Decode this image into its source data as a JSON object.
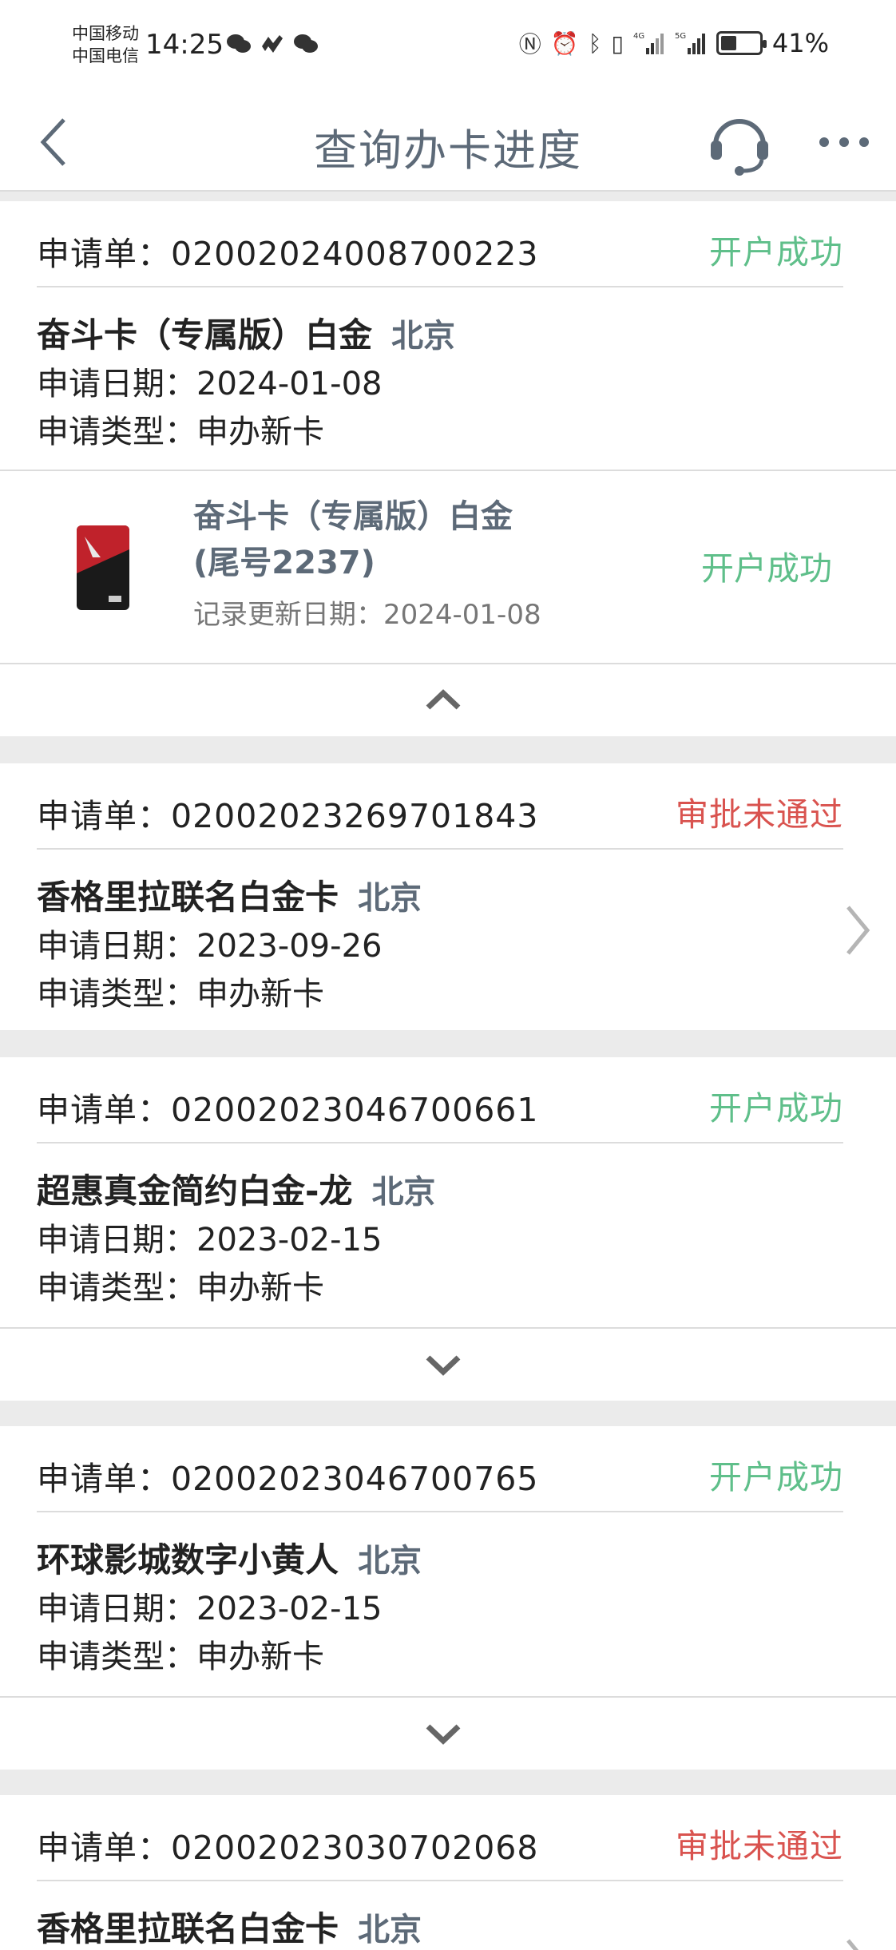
{
  "status_bar": {
    "carrier_1": "中国移动",
    "carrier_2": "中国电信",
    "time": "14:25",
    "battery": "41%",
    "battery_level": 0.41,
    "network_4g": "4G",
    "network_5g": "5G"
  },
  "nav": {
    "title": "查询办卡进度",
    "back_icon": "back-chevron-icon",
    "service_icon": "headset-icon",
    "more_icon": "more-dots-icon"
  },
  "colors": {
    "success": "#5fbf8a",
    "fail": "#d9534f",
    "title": "#5d6a78"
  },
  "applications": [
    {
      "app_label": "申请单：",
      "app_no": "02002024008700223",
      "status": "开户成功",
      "card_name": "奋斗卡（专属版）白金",
      "city": "北京",
      "date_label": "申请日期：",
      "date": "2024-01-08",
      "type_label": "申请类型：",
      "type": "申办新卡",
      "detail": {
        "name_line1": "奋斗卡（专属版）白金",
        "name_line2": "(尾号2237)",
        "update_label": "记录更新日期：",
        "update_date": "2024-01-08",
        "status": "开户成功"
      },
      "toggle": "collapse-chevron-icon"
    },
    {
      "app_label": "申请单：",
      "app_no": "02002023269701843",
      "status": "审批未通过",
      "card_name": "香格里拉联名白金卡",
      "city": "北京",
      "date_label": "申请日期：",
      "date": "2023-09-26",
      "type_label": "申请类型：",
      "type": "申办新卡"
    },
    {
      "app_label": "申请单：",
      "app_no": "02002023046700661",
      "status": "开户成功",
      "card_name": "超惠真金简约白金-龙",
      "city": "北京",
      "date_label": "申请日期：",
      "date": "2023-02-15",
      "type_label": "申请类型：",
      "type": "申办新卡",
      "toggle": "expand-chevron-icon"
    },
    {
      "app_label": "申请单：",
      "app_no": "02002023046700765",
      "status": "开户成功",
      "card_name": "环球影城数字小黄人",
      "city": "北京",
      "date_label": "申请日期：",
      "date": "2023-02-15",
      "type_label": "申请类型：",
      "type": "申办新卡",
      "toggle": "expand-chevron-icon"
    },
    {
      "app_label": "申请单：",
      "app_no": "02002023030702068",
      "status": "审批未通过",
      "card_name": "香格里拉联名白金卡",
      "city": "北京"
    }
  ]
}
